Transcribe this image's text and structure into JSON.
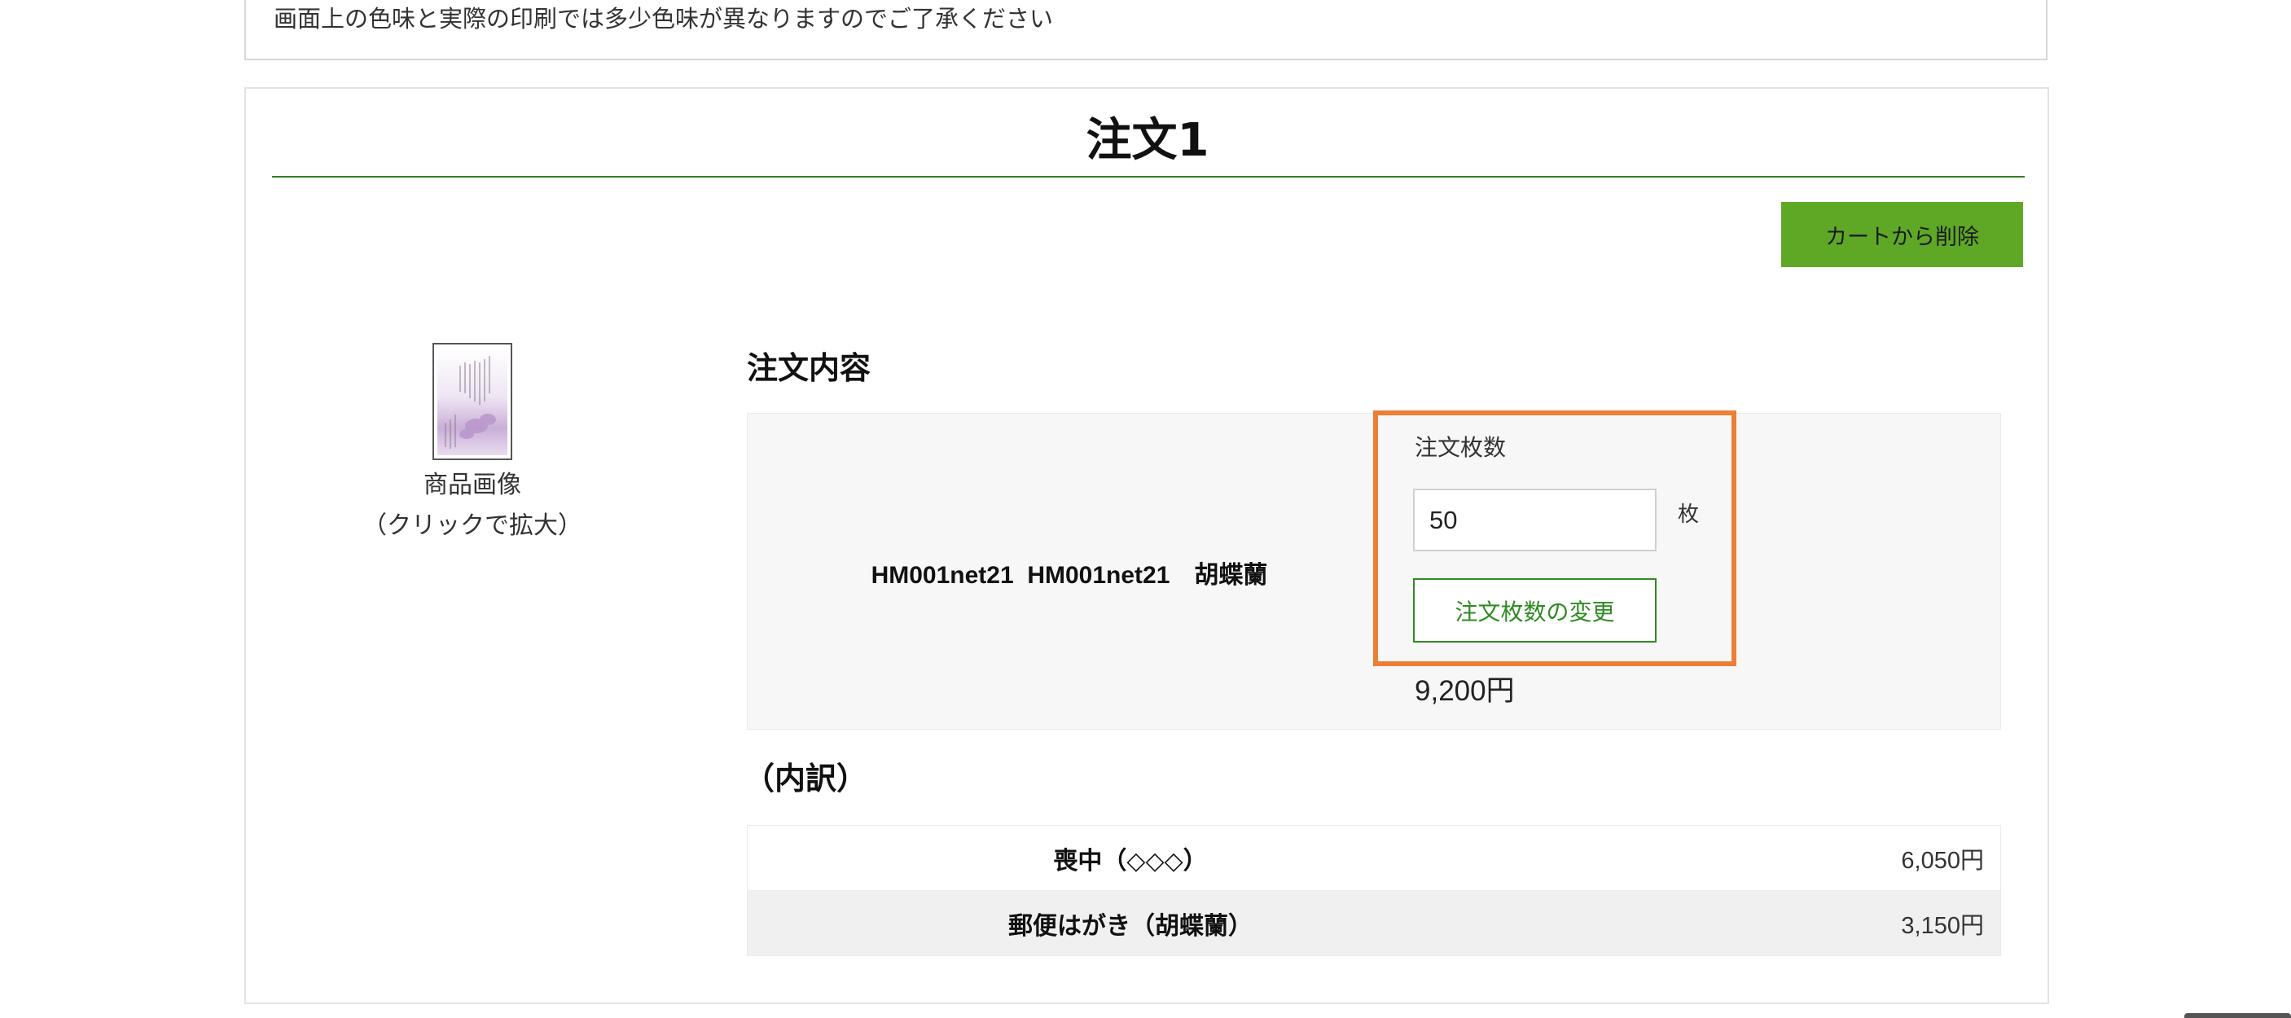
{
  "notice": {
    "text": "画面上の色味と実際の印刷では多少色味が異なりますのでご了承ください"
  },
  "order": {
    "title": "注文1",
    "delete_button_label": "カートから削除",
    "product_image": {
      "icon": "postcard-thumbnail-icon",
      "caption_line1": "商品画像",
      "caption_line2": "（クリックで拡大）"
    },
    "details_heading": "注文内容",
    "product_name": "HM001net21  HM001net21　胡蝶蘭",
    "quantity": {
      "label": "注文枚数",
      "value": "50",
      "unit": "枚",
      "change_button_label": "注文枚数の変更"
    },
    "price": "9,200円",
    "breakdown_heading": "（内訳）",
    "breakdown": [
      {
        "item": "喪中（◇◇◇）",
        "price": "6,050円"
      },
      {
        "item": "郵便はがき（胡蝶蘭）",
        "price": "3,150円"
      }
    ]
  },
  "colors": {
    "accent_green": "#5fa826",
    "title_rule_green": "#2f7d1f",
    "highlight_orange": "#ec7f35"
  }
}
